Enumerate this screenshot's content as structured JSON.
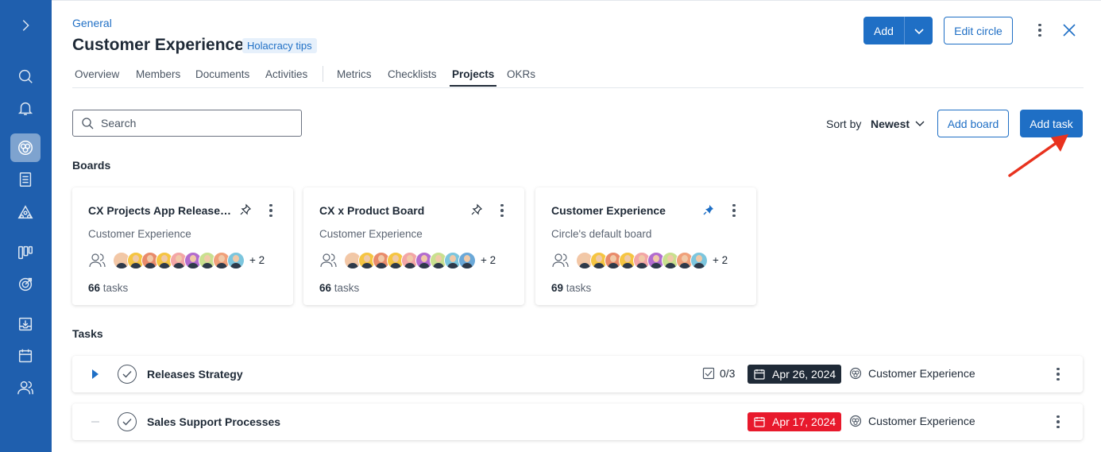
{
  "breadcrumb": "General",
  "title": "Customer Experience",
  "tips_badge": "Holacracy tips",
  "tabs": [
    {
      "label": "Overview"
    },
    {
      "label": "Members"
    },
    {
      "label": "Documents"
    },
    {
      "label": "Activities"
    },
    {
      "label": "Metrics"
    },
    {
      "label": "Checklists"
    },
    {
      "label": "Projects",
      "active": true
    },
    {
      "label": "OKRs"
    }
  ],
  "header_actions": {
    "add_label": "Add",
    "edit_circle_label": "Edit circle"
  },
  "toolbar": {
    "search_placeholder": "Search",
    "sort_label": "Sort by",
    "sort_value": "Newest",
    "add_board_label": "Add board",
    "add_task_label": "Add task"
  },
  "boards_title": "Boards",
  "boards": [
    {
      "name": "CX Projects App Release Bo...",
      "circle": "Customer Experience",
      "more_members": "+ 2",
      "task_count": "66",
      "tasks_suffix": "tasks",
      "pinned": false
    },
    {
      "name": "CX x Product Board",
      "circle": "Customer Experience",
      "more_members": "+ 2",
      "task_count": "66",
      "tasks_suffix": "tasks",
      "pinned": false
    },
    {
      "name": "Customer Experience",
      "circle": "Circle's default board",
      "more_members": "+ 2",
      "task_count": "69",
      "tasks_suffix": "tasks",
      "pinned": true
    }
  ],
  "avatar_colors": [
    "#f3c7a6",
    "#f5c542",
    "#e98b6b",
    "#f5c542",
    "#f3a6a6",
    "#b26ccf",
    "#c9e08f",
    "#f0a07a",
    "#7cc6de",
    "#6aa8d8"
  ],
  "tasks_title": "Tasks",
  "tasks": [
    {
      "name": "Releases Strategy",
      "subtasks": "0/3",
      "due": "Apr 26, 2024",
      "due_color": "#1f2a37",
      "circle": "Customer Experience",
      "expandable": true
    },
    {
      "name": "Sales Support Processes",
      "subtasks": "",
      "due": "Apr 17, 2024",
      "due_color": "#e8192c",
      "circle": "Customer Experience",
      "expandable": false
    }
  ],
  "colors": {
    "rail": "#1f5fae",
    "accent": "#1f6fc5",
    "annotation_arrow": "#e8321e"
  },
  "rail_icons": [
    "expand-icon",
    "search-icon",
    "bell-icon",
    "circles-icon",
    "document-icon",
    "roles-icon",
    "board-icon",
    "target-icon",
    "inbox-icon",
    "calendar-icon",
    "people-icon"
  ]
}
